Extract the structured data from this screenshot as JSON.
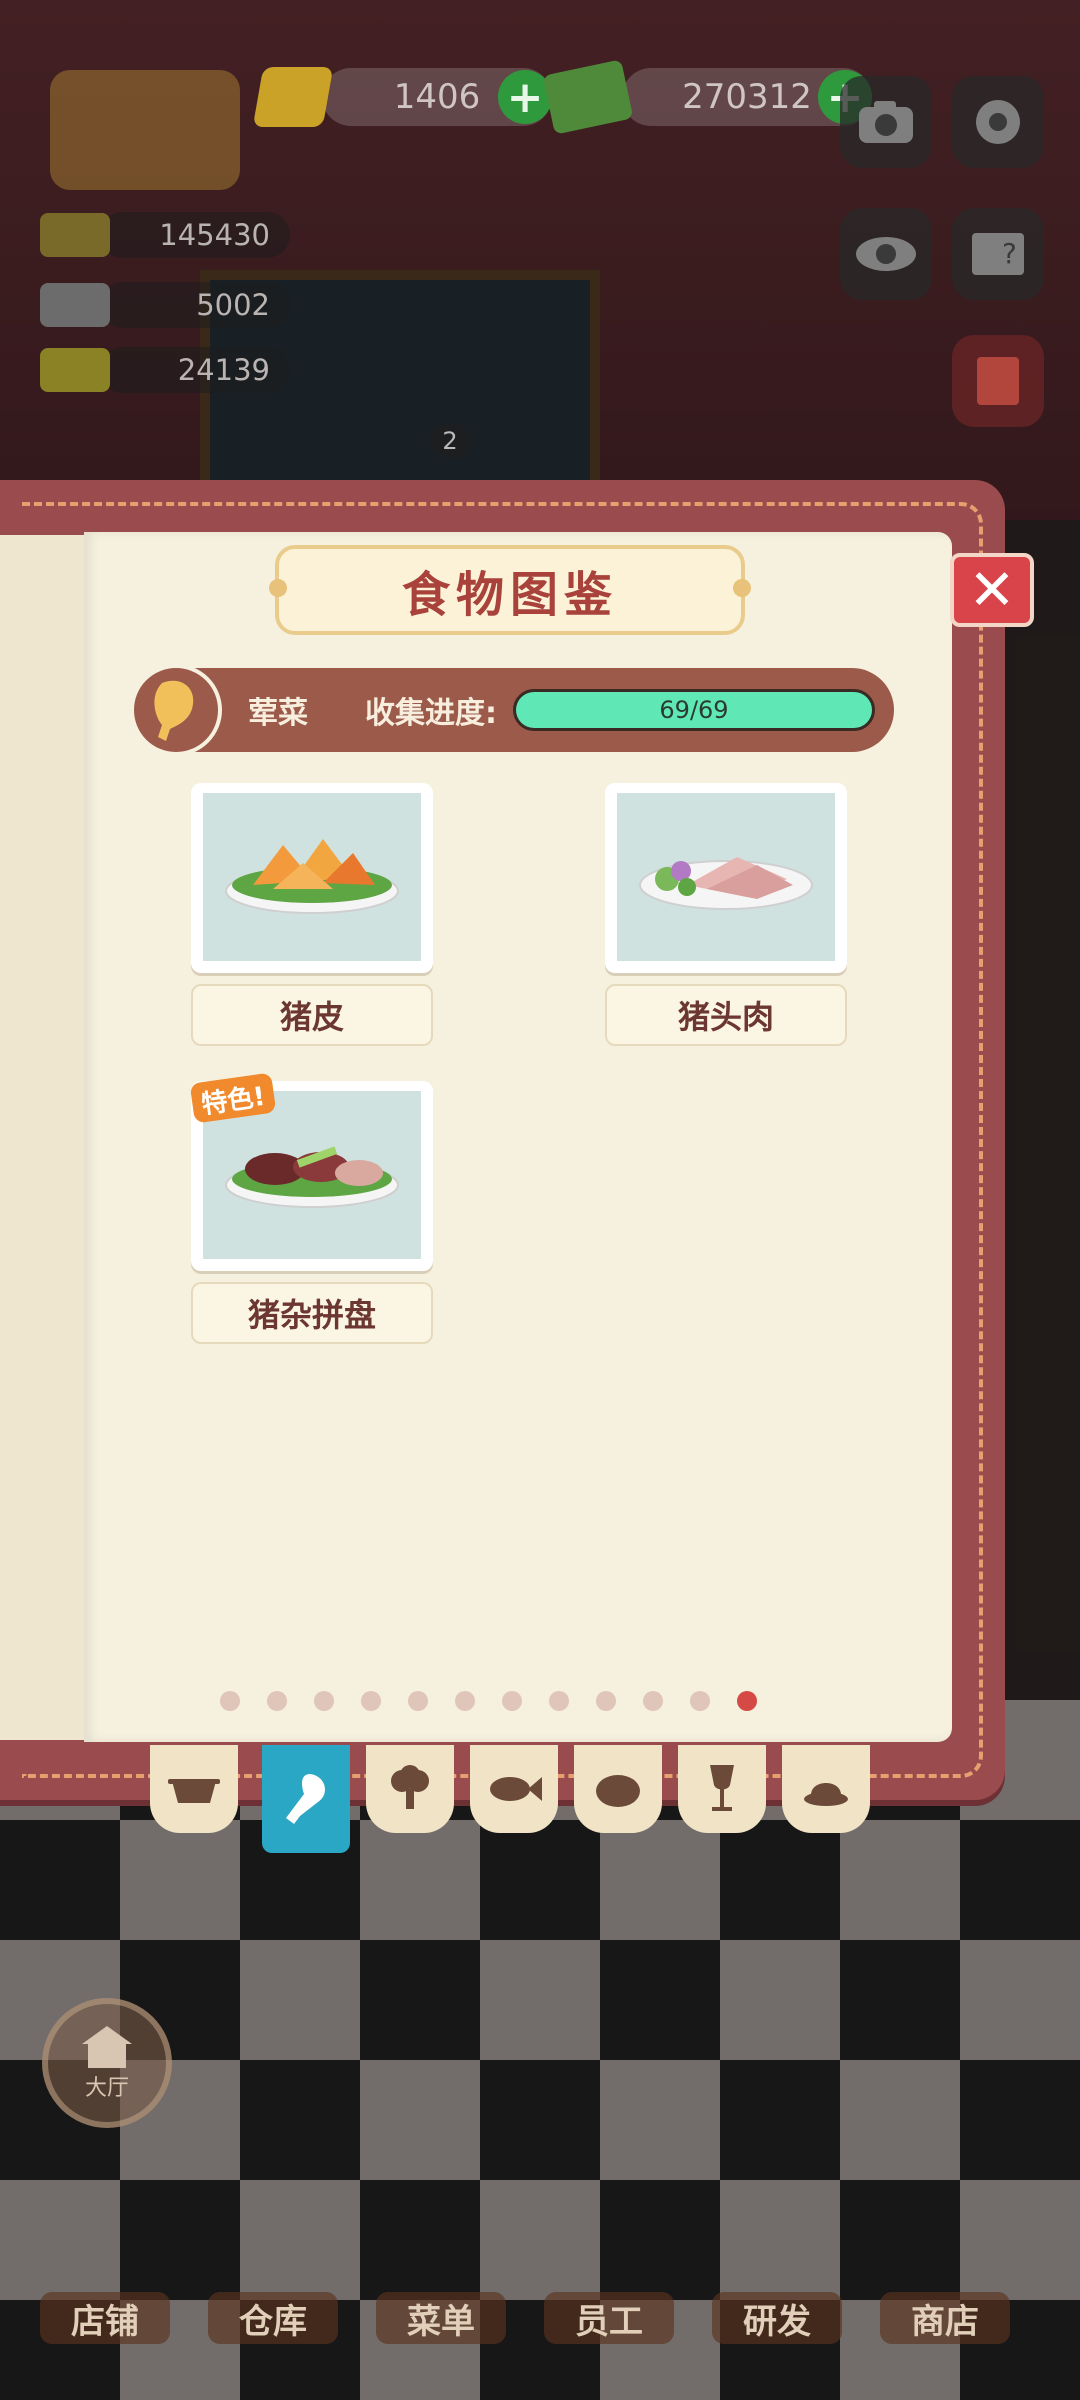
{
  "hud": {
    "gems": "1406",
    "cash": "270312",
    "res1": "145430",
    "res2": "5002",
    "res3": "24139",
    "order_count": "2"
  },
  "book": {
    "title": "食物图鉴",
    "category": "荤菜",
    "progress_label": "收集进度:",
    "progress_current": "69",
    "progress_total": "/69",
    "progress_fraction": 1.0,
    "close_symbol": "✕"
  },
  "foods": [
    {
      "name": "猪皮"
    },
    {
      "name": "猪头肉"
    },
    {
      "name": "猪杂拼盘",
      "badge": "特色!"
    }
  ],
  "page_dots": {
    "count": 12,
    "active": 11
  },
  "category_tabs": [
    "pot-icon",
    "drumstick-icon",
    "broccoli-icon",
    "fish-icon",
    "bread-icon",
    "wine-glass-icon",
    "dessert-icon"
  ],
  "nav": {
    "hall": "大厅",
    "items": [
      "店铺",
      "仓库",
      "菜单",
      "员工",
      "研发",
      "商店"
    ]
  },
  "colors": {
    "accent_red": "#d54a44",
    "progress_fill": "#5fe8b6",
    "active_tab": "#2aa7c5"
  }
}
